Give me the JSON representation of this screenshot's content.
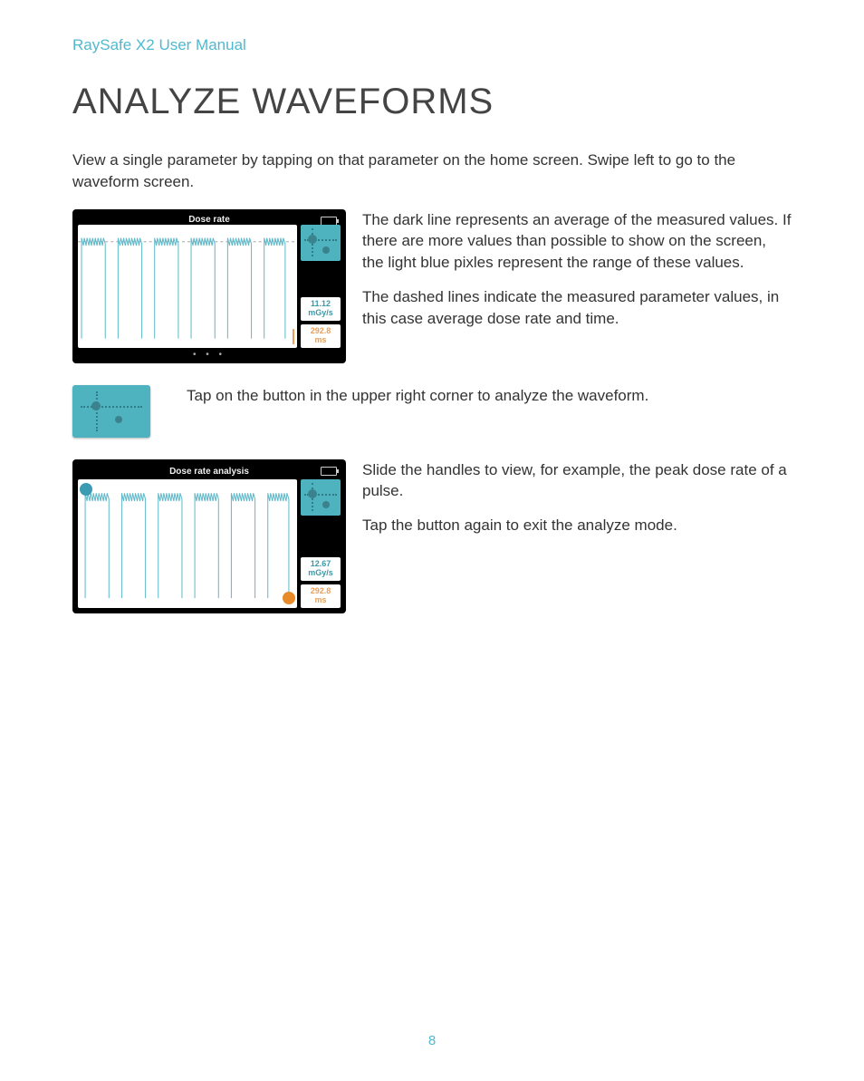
{
  "header": "RaySafe X2 User Manual",
  "title": "ANALYZE WAVEFORMS",
  "intro": "View a single parameter by tapping on that parameter on the home screen. Swipe left to go to the waveform screen.",
  "section1": {
    "device_title": "Dose rate",
    "val1": "11.12",
    "unit1": "mGy/s",
    "val2": "292.8",
    "unit2": "ms",
    "p1": "The dark line represents an average of the measured values. If there are more values than possible to show on the screen, the light blue pixles represent the range of these values.",
    "p2": "The dashed lines indicate the measured parameter values, in this case average dose rate and time."
  },
  "section2": {
    "text": "Tap on the button in the upper right corner to analyze the waveform."
  },
  "section3": {
    "device_title": "Dose rate analysis",
    "val1": "12.67",
    "unit1": "mGy/s",
    "val2": "292.8",
    "unit2": "ms",
    "p1": "Slide the handles to view, for example, the peak dose rate of a pulse.",
    "p2": "Tap the button again to exit the analyze mode."
  },
  "page_number": "8",
  "chart_data": [
    {
      "type": "line",
      "title": "Dose rate",
      "ylabel": "mGy/s",
      "xlabel": "ms",
      "avg_value": 11.12,
      "time_window_ms": 292.8,
      "description": "Six repeating pulse bursts; dark line is average, light blue band is range; dashed horizontal line at avg_value."
    },
    {
      "type": "line",
      "title": "Dose rate analysis",
      "ylabel": "mGy/s",
      "xlabel": "ms",
      "peak_value": 12.67,
      "time_window_ms": 292.8,
      "description": "Same six pulse bursts with draggable blue (top-left) and orange (bottom-right) analysis handles."
    }
  ]
}
